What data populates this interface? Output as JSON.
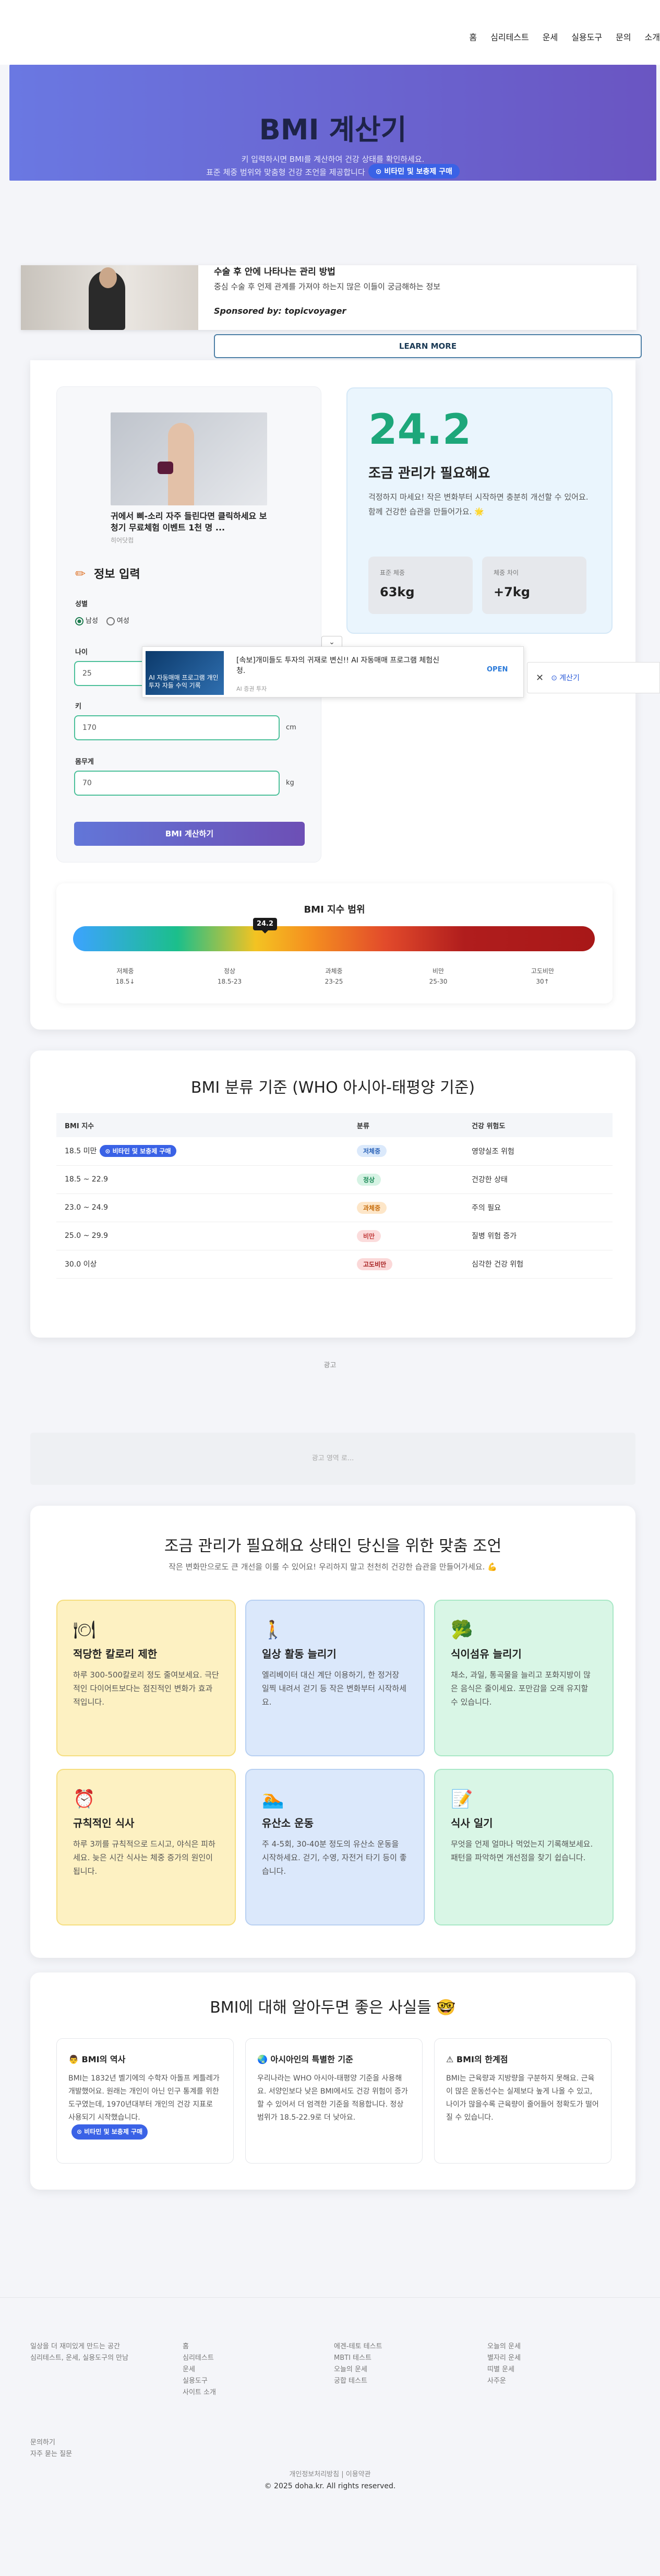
{
  "nav": [
    "홈",
    "심리테스트",
    "운세",
    "실용도구",
    "문의",
    "소개"
  ],
  "hero": {
    "title": "BMI 계산기",
    "sub1": "키 입력하시면 BMI를 계산하여 건강 상태를 확인하세요.",
    "sub2": "표준 체중 범위와 맞춤형 건강 조언을 제공합니다",
    "pill": "⊙ 비타민 및 보충제 구매"
  },
  "ad_top": {
    "title": "수술 후 안에 나타나는 관리 방법",
    "desc": "중심 수술 후 언제 관계를 가져야 하는지 많은 이들이 궁금해하는 정보",
    "sponsor": "Sponsored by: topicvoyager",
    "button": "LEARN MORE"
  },
  "input_ad": {
    "title": "귀에서 삐-소리 자주 들린다면 클릭하세요 보청기 무료체험 이벤트 1천 명 ...",
    "source": "히어닷컴"
  },
  "form": {
    "title": "정보 입력",
    "gender_label": "성별",
    "male": "남성",
    "female": "여성",
    "age_label": "나이",
    "age_value": "25",
    "height_label": "키",
    "height_value": "170",
    "height_unit": "cm",
    "weight_label": "몸무게",
    "weight_value": "70",
    "weight_unit": "kg",
    "submit": "BMI 계산하기"
  },
  "result": {
    "bmi": "24.2",
    "category": "조금 관리가 필요해요",
    "message": "걱정하지 마세요! 작은 변화부터 시작하면 충분히 개선할 수 있어요. 함께 건강한 습관을 만들어가요. 🌟",
    "stat1_label": "표준 체중",
    "stat1_value": "63kg",
    "stat2_label": "체중 차이",
    "stat2_value": "+7kg",
    "bmi_num": 24.2
  },
  "popup_ad": {
    "img_text": "AI 자동매매 프로그램 개인투자 자들 수익 기록",
    "title": "[속보]개미들도 투자의 귀재로 변신!! AI 자동매매 프로그램 체험신청.",
    "source": "AI 증권 투자",
    "open": "OPEN",
    "close": "✕",
    "calc": "⊙ 계산기",
    "chevron": "⌄"
  },
  "range": {
    "title": "BMI 지수 범위",
    "labels": [
      [
        "저체중",
        "18.5↓"
      ],
      [
        "정상",
        "18.5-23"
      ],
      [
        "과체중",
        "23-25"
      ],
      [
        "비만",
        "25-30"
      ],
      [
        "고도비만",
        "30↑"
      ]
    ]
  },
  "classification": {
    "title": "BMI 분류 기준 (WHO 아시아-태평양 기준)",
    "headers": [
      "BMI 지수",
      "분류",
      "건강 위험도"
    ],
    "rows": [
      [
        "18.5 미만",
        "저체중",
        "영양실조 위험"
      ],
      [
        "18.5 ~ 22.9",
        "정상",
        "건강한 상태"
      ],
      [
        "23.0 ~ 24.9",
        "과체중",
        "주의 필요"
      ],
      [
        "25.0 ~ 29.9",
        "비만",
        "질병 위험 증가"
      ],
      [
        "30.0 이상",
        "고도비만",
        "심각한 건강 위험"
      ]
    ],
    "pill": "⊙ 비타민 및 보충제 구매"
  },
  "ad_label": "광고",
  "ad_placeholder": "광고 영역 로...",
  "tips": {
    "title": "조금 관리가 필요해요 상태인 당신을 위한 맞춤 조언",
    "subtitle": "작은 변화만으로도 큰 개선을 이룰 수 있어요! 우리하지 말고 천천히 건강한 습관을 만들어가세요. 💪",
    "items": [
      {
        "icon": "🍽",
        "title": "적당한 칼로리 제한",
        "desc": "하루 300-500칼로리 정도 줄여보세요. 극단적인 다이어트보다는 점진적인 변화가 효과적입니다."
      },
      {
        "icon": "🚶",
        "title": "일상 활동 늘리기",
        "desc": "엘리베이터 대신 계단 이용하기, 한 정거장 일찍 내려서 걷기 등 작은 변화부터 시작하세요."
      },
      {
        "icon": "🥦",
        "title": "식이섬유 늘리기",
        "desc": "채소, 과일, 통곡물을 늘리고 포화지방이 많은 음식은 줄이세요. 포만감을 오래 유지할 수 있습니다."
      },
      {
        "icon": "⏰",
        "title": "규칙적인 식사",
        "desc": "하루 3끼를 규칙적으로 드시고, 야식은 피하세요. 늦은 시간 식사는 체중 증가의 원인이 됩니다."
      },
      {
        "icon": "🏊",
        "title": "유산소 운동",
        "desc": "주 4-5회, 30-40분 정도의 유산소 운동을 시작하세요. 걷기, 수영, 자전거 타기 등이 좋습니다."
      },
      {
        "icon": "📝",
        "title": "식사 일기",
        "desc": "무엇을 언제 얼마나 먹었는지 기록해보세요. 패턴을 파악하면 개선점을 찾기 쉽습니다."
      }
    ]
  },
  "facts": {
    "title": "BMI에 대해 알아두면 좋은 사실들 🤓",
    "items": [
      {
        "icon": "👨",
        "title": "BMI의 역사",
        "desc": "BMI는 1832년 벨기에의 수학자 아돌프 케틀레가 개발했어요. 원래는 개인이 아닌 인구 통계를 위한 도구였는데, 1970년대부터 개인의 건강 지표로 사용되기 시작했습니다."
      },
      {
        "icon": "🌏",
        "title": "아시아인의 특별한 기준",
        "desc": "우리나라는 WHO 아시아-태평양 기준을 사용해요. 서양인보다 낮은 BMI에서도 건강 위험이 증가할 수 있어서 더 엄격한 기준을 적용합니다. 정상 범위가 18.5-22.9로 더 낮아요."
      },
      {
        "icon": "⚠",
        "title": "BMI의 한계점",
        "desc": "BMI는 근육량과 지방량을 구분하지 못해요. 근육이 많은 운동선수는 실제보다 높게 나올 수 있고, 나이가 많을수록 근육량이 줄어들어 정확도가 떨어질 수 있습니다."
      }
    ],
    "pill": "⊙ 비타민 및 보충제 구매"
  },
  "footer": {
    "col1": [
      "일상을 더 재미있게 만드는 공간",
      "심리테스트, 운세, 실용도구의 만남"
    ],
    "col1b": [
      "문의하기",
      "자주 묻는 질문"
    ],
    "col2": [
      "홈",
      "심리테스트",
      "운세",
      "실용도구",
      "사이트 소개"
    ],
    "col3": [
      "에겐-테토 테스트",
      "MBTI 테스트",
      "오늘의 운세",
      "궁합 테스트"
    ],
    "col4": [
      "오늘의 운세",
      "별자리 운세",
      "띠별 운세",
      "사주운"
    ],
    "policy": "개인정보처리방침 | 이용약관",
    "copy": "© 2025 doha.kr. All rights reserved."
  },
  "colors": {
    "accent": "#1da77a",
    "hero_start": "#6a78e2",
    "hero_end": "#6a55c2"
  }
}
